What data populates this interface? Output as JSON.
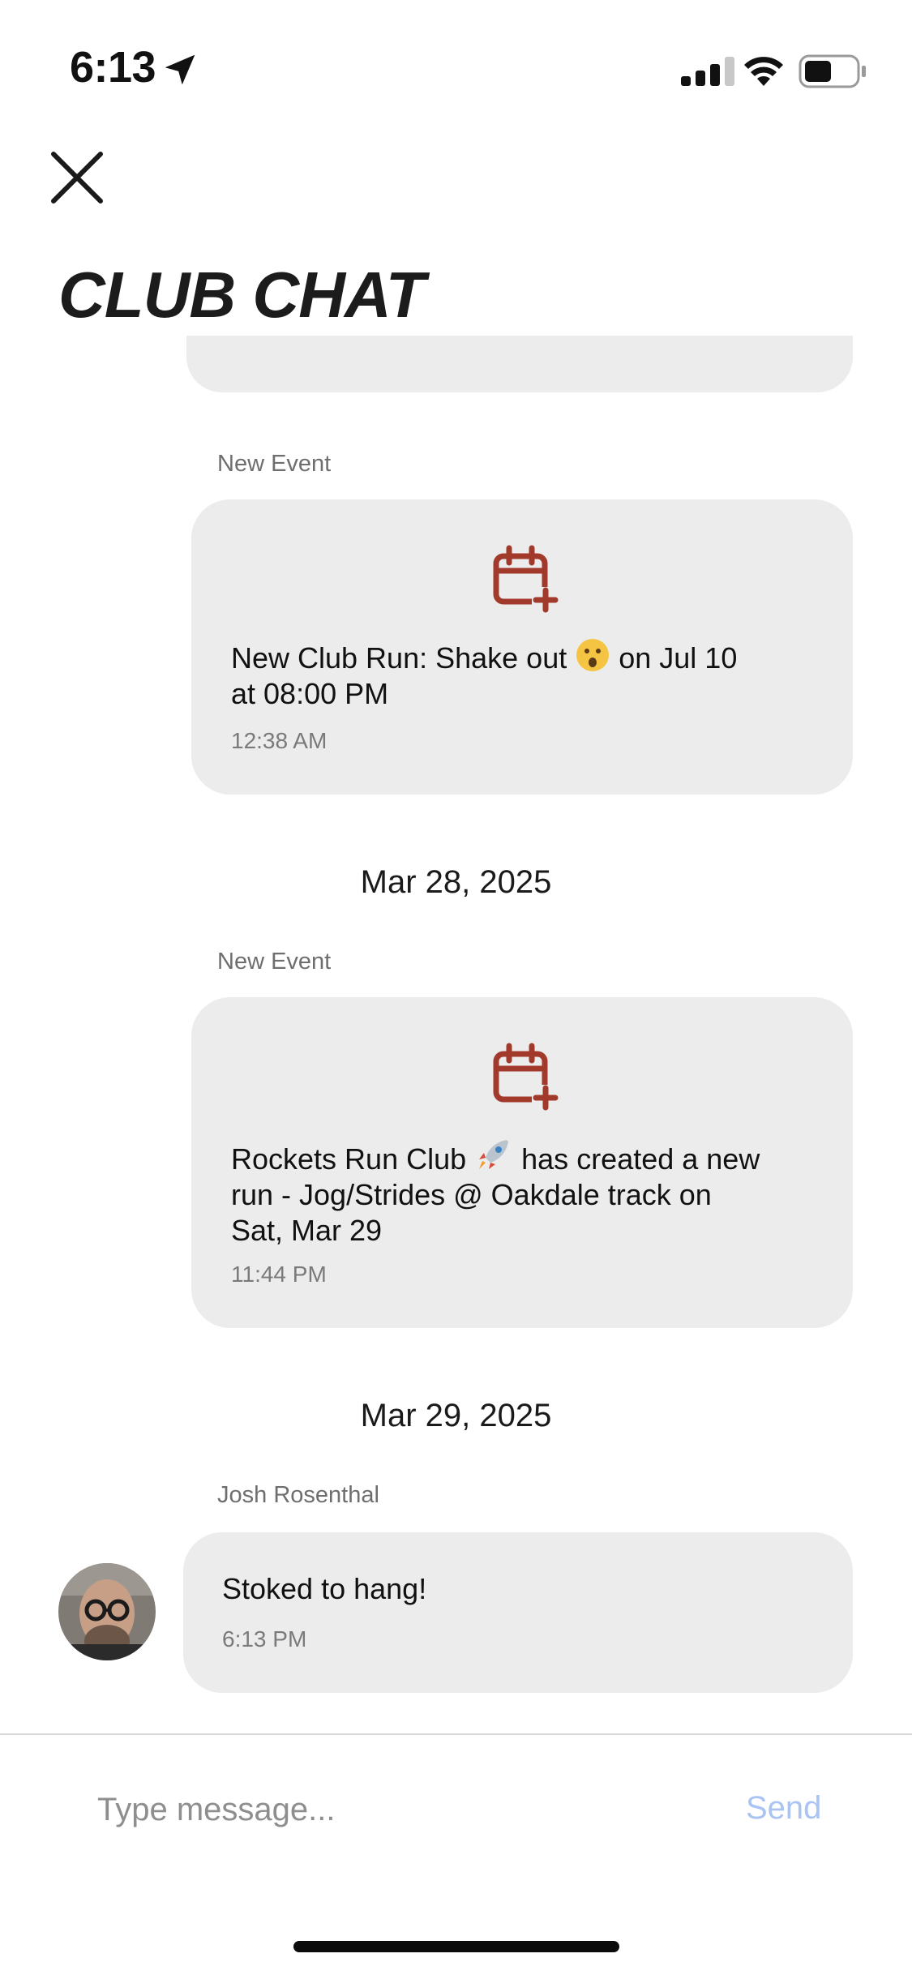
{
  "status_bar": {
    "time": "6:13"
  },
  "header": {
    "title": "CLUB CHAT"
  },
  "messages": [
    {
      "sender": "New Event",
      "text_before": "New Club Run: Shake out ",
      "text_after": " on Jul 10",
      "text_line2": "at 08:00 PM",
      "time": "12:38 AM",
      "emoji": "face-emoji"
    },
    {
      "sender": "New Event",
      "text_before": "Rockets Run Club ",
      "text_after": " has created a new",
      "text_line2": "run - Jog/Strides @ Oakdale track on",
      "text_line3": "Sat, Mar 29",
      "time": "11:44 PM",
      "emoji": "rocket-emoji"
    },
    {
      "sender": "Josh Rosenthal",
      "text": "Stoked to hang!",
      "time": "6:13 PM"
    }
  ],
  "date_separators": [
    "Mar 28, 2025",
    "Mar 29, 2025"
  ],
  "composer": {
    "placeholder": "Type message...",
    "send_label": "Send"
  },
  "colors": {
    "event_icon": "#a23a2c",
    "bubble": "#ececec",
    "send": "#a9c3f3"
  }
}
